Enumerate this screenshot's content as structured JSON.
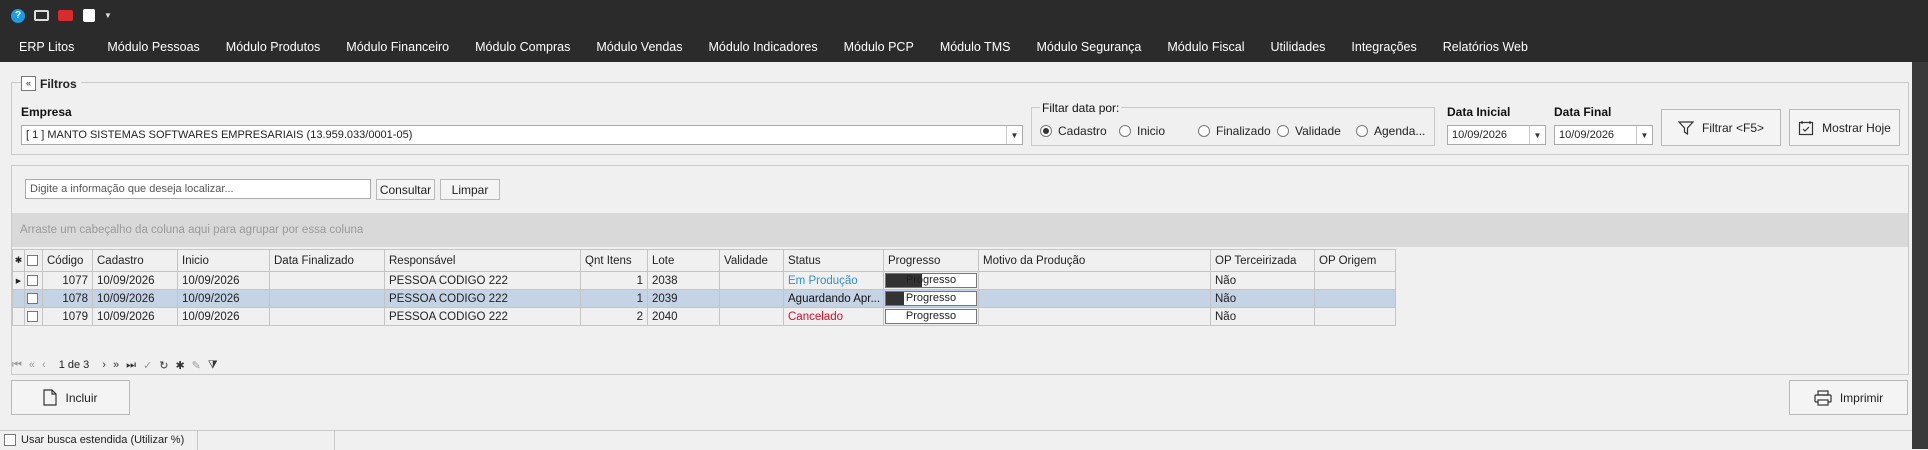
{
  "quick_access": {
    "icons": [
      "help-icon",
      "monitor-icon",
      "video-icon",
      "clipboard-icon",
      "dropdown-icon"
    ]
  },
  "menu": [
    "ERP Litos",
    "Módulo Pessoas",
    "Módulo Produtos",
    "Módulo Financeiro",
    "Módulo Compras",
    "Módulo Vendas",
    "Módulo Indicadores",
    "Módulo PCP",
    "Módulo TMS",
    "Módulo Segurança",
    "Módulo Fiscal",
    "Utilidades",
    "Integrações",
    "Relatórios Web"
  ],
  "filters": {
    "title": "Filtros",
    "empresa_label": "Empresa",
    "empresa_value": "[ 1 ] MANTO SISTEMAS SOFTWARES EMPRESARIAIS (13.959.033/0001-05)",
    "filtrar_data_label": "Filtar data por:",
    "radios": [
      "Cadastro",
      "Inicio",
      "Finalizado",
      "Validade",
      "Agenda..."
    ],
    "radio_selected": "Cadastro",
    "data_inicial_label": "Data Inicial",
    "data_inicial": "10/09/2026",
    "data_final_label": "Data Final",
    "data_final": "10/09/2026",
    "filtrar_button": "Filtrar <F5>",
    "mostrar_hoje_button": "Mostrar Hoje"
  },
  "search": {
    "placeholder": "Digite a informação que deseja localizar...",
    "consultar": "Consultar",
    "limpar": "Limpar"
  },
  "group_hint": "Arraste um cabeçalho da coluna aqui para agrupar por essa coluna",
  "grid": {
    "columns": [
      "Código",
      "Cadastro",
      "Inicio",
      "Data Finalizado",
      "Responsável",
      "Qnt Itens",
      "Lote",
      "Validade",
      "Status",
      "Progresso",
      "Motivo da Produção",
      "OP Terceirizada",
      "OP Origem"
    ],
    "rows": [
      {
        "codigo": "1077",
        "cadastro": "10/09/2026",
        "inicio": "10/09/2026",
        "data_finalizado": "",
        "responsavel": "PESSOA CODIGO 222",
        "qnt": "1",
        "lote": "2038",
        "validade": "",
        "status": "Em Produção",
        "status_color": "#2f8fd0",
        "progresso_text": "Progresso",
        "progresso": 0.4,
        "motivo": "",
        "op_terc": "Não",
        "op_origem": ""
      },
      {
        "codigo": "1078",
        "cadastro": "10/09/2026",
        "inicio": "10/09/2026",
        "data_finalizado": "",
        "responsavel": "PESSOA CODIGO 222",
        "qnt": "1",
        "lote": "2039",
        "validade": "",
        "status": "Aguardando Apr...",
        "status_color": "#111111",
        "progresso_text": "Progresso",
        "progresso": 0.2,
        "motivo": "",
        "op_terc": "Não",
        "op_origem": ""
      },
      {
        "codigo": "1079",
        "cadastro": "10/09/2026",
        "inicio": "10/09/2026",
        "data_finalizado": "",
        "responsavel": "PESSOA CODIGO 222",
        "qnt": "2",
        "lote": "2040",
        "validade": "",
        "status": "Cancelado",
        "status_color": "#d0102a",
        "progresso_text": "Progresso",
        "progresso": 0,
        "motivo": "",
        "op_terc": "Não",
        "op_origem": ""
      }
    ]
  },
  "pager": {
    "text": "1 de 3"
  },
  "bottom": {
    "incluir": "Incluir",
    "imprimir": "Imprimir"
  },
  "status": {
    "busca_estendida": "Usar busca estendida (Utilizar %)"
  }
}
